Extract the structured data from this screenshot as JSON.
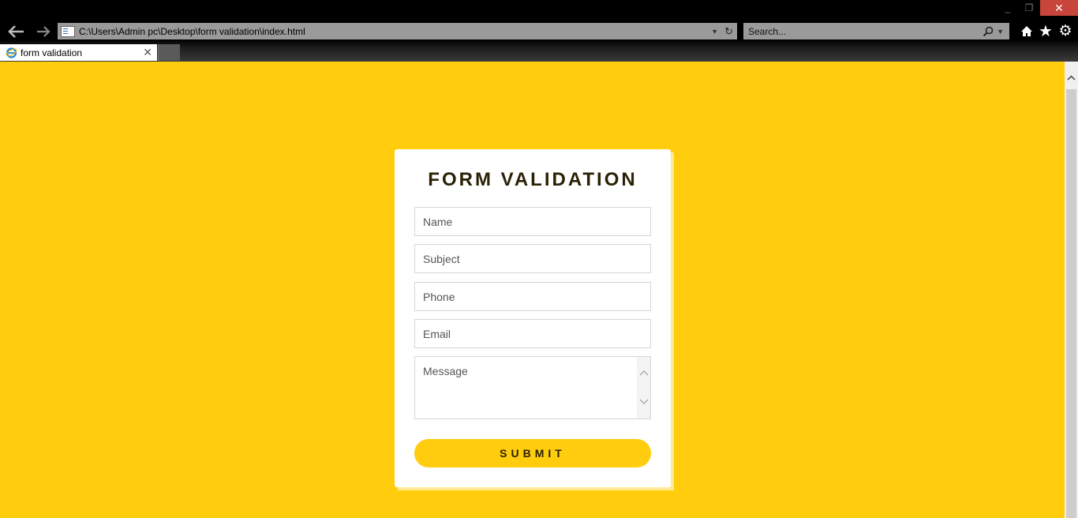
{
  "browser": {
    "address": "C:\\Users\\Admin pc\\Desktop\\form validation\\index.html",
    "search_placeholder": "Search...",
    "tab_title": "form validation",
    "window_controls": {
      "minimize": "_",
      "maximize": "❐",
      "close": "✕"
    },
    "icons": [
      "back-arrow-icon",
      "forward-arrow-icon",
      "page-icon",
      "dropdown-icon",
      "refresh-icon",
      "search-icon",
      "home-icon",
      "favorites-star-icon",
      "settings-gear-icon",
      "ie-logo-icon",
      "close-icon"
    ]
  },
  "form": {
    "title": "FORM VALIDATION",
    "fields": {
      "name_placeholder": "Name",
      "subject_placeholder": "Subject",
      "phone_placeholder": "Phone",
      "email_placeholder": "Email",
      "message_placeholder": "Message"
    },
    "submit_label": "SUBMIT"
  },
  "colors": {
    "page_background": "#ffcd0d",
    "accent": "#ffcd0d",
    "title_text": "#2b2105",
    "card_background": "#ffffff"
  }
}
